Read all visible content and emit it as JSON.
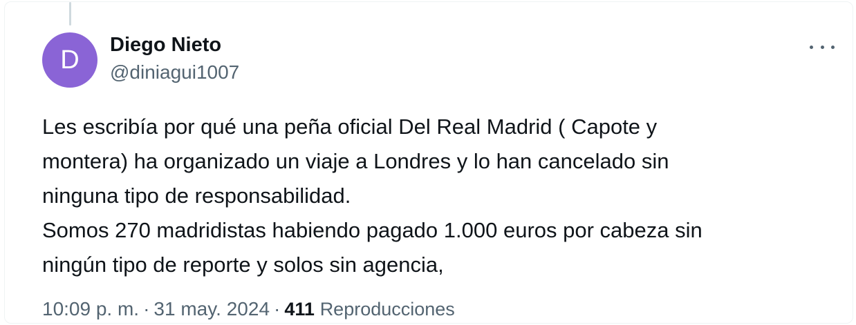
{
  "tweet": {
    "author": {
      "avatar_initial": "D",
      "avatar_color": "#8a64d6",
      "display_name": "Diego Nieto",
      "handle": "@diniagui1007"
    },
    "more_icon": "more-horizontal-icon",
    "text_lines": [
      "Les escribía por qué una peña oficial Del Real Madrid ( Capote y",
      "montera) ha organizado un viaje a Londres y lo han cancelado sin",
      "ninguna tipo de responsabilidad.",
      "Somos 270 madridistas habiendo pagado 1.000 euros por cabeza sin",
      "ningún tipo de reporte y solos sin agencia,"
    ],
    "time": "10:09 p. m.",
    "separator": "·",
    "date": "31 may. 2024",
    "views_count": "411",
    "views_label": "Reproducciones"
  }
}
